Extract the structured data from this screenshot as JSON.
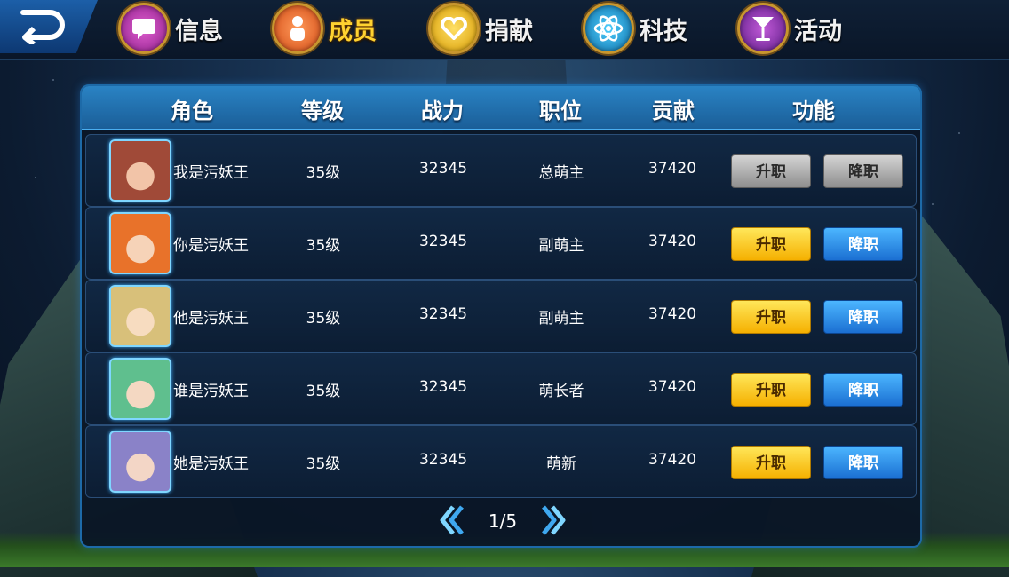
{
  "nav": {
    "tabs": [
      {
        "label": "信息",
        "icon": "chat-icon",
        "active": false
      },
      {
        "label": "成员",
        "icon": "member-icon",
        "active": true
      },
      {
        "label": "捐献",
        "icon": "heart-icon",
        "active": false
      },
      {
        "label": "科技",
        "icon": "atom-icon",
        "active": false
      },
      {
        "label": "活动",
        "icon": "cocktail-icon",
        "active": false
      }
    ]
  },
  "table": {
    "headers": {
      "role": "角色",
      "level": "等级",
      "power": "战力",
      "position": "职位",
      "contribution": "贡献",
      "function": "功能"
    },
    "rows": [
      {
        "name": "我是污妖王",
        "level": "35级",
        "power": "32345",
        "position": "总萌主",
        "contribution": "37420",
        "promote": "升职",
        "demote": "降职",
        "enabled": false
      },
      {
        "name": "你是污妖王",
        "level": "35级",
        "power": "32345",
        "position": "副萌主",
        "contribution": "37420",
        "promote": "升职",
        "demote": "降职",
        "enabled": true
      },
      {
        "name": "他是污妖王",
        "level": "35级",
        "power": "32345",
        "position": "副萌主",
        "contribution": "37420",
        "promote": "升职",
        "demote": "降职",
        "enabled": true
      },
      {
        "name": "谁是污妖王",
        "level": "35级",
        "power": "32345",
        "position": "萌长者",
        "contribution": "37420",
        "promote": "升职",
        "demote": "降职",
        "enabled": true
      },
      {
        "name": "她是污妖王",
        "level": "35级",
        "power": "32345",
        "position": "萌新",
        "contribution": "37420",
        "promote": "升职",
        "demote": "降职",
        "enabled": true
      }
    ]
  },
  "pager": {
    "text": "1/5"
  },
  "colors": {
    "accent_gold": "#ffd230",
    "header_blue": "#2a83c4",
    "button_yellow": "#f5b000",
    "button_blue": "#1b6fd2",
    "button_gray": "#8e8e8e"
  }
}
